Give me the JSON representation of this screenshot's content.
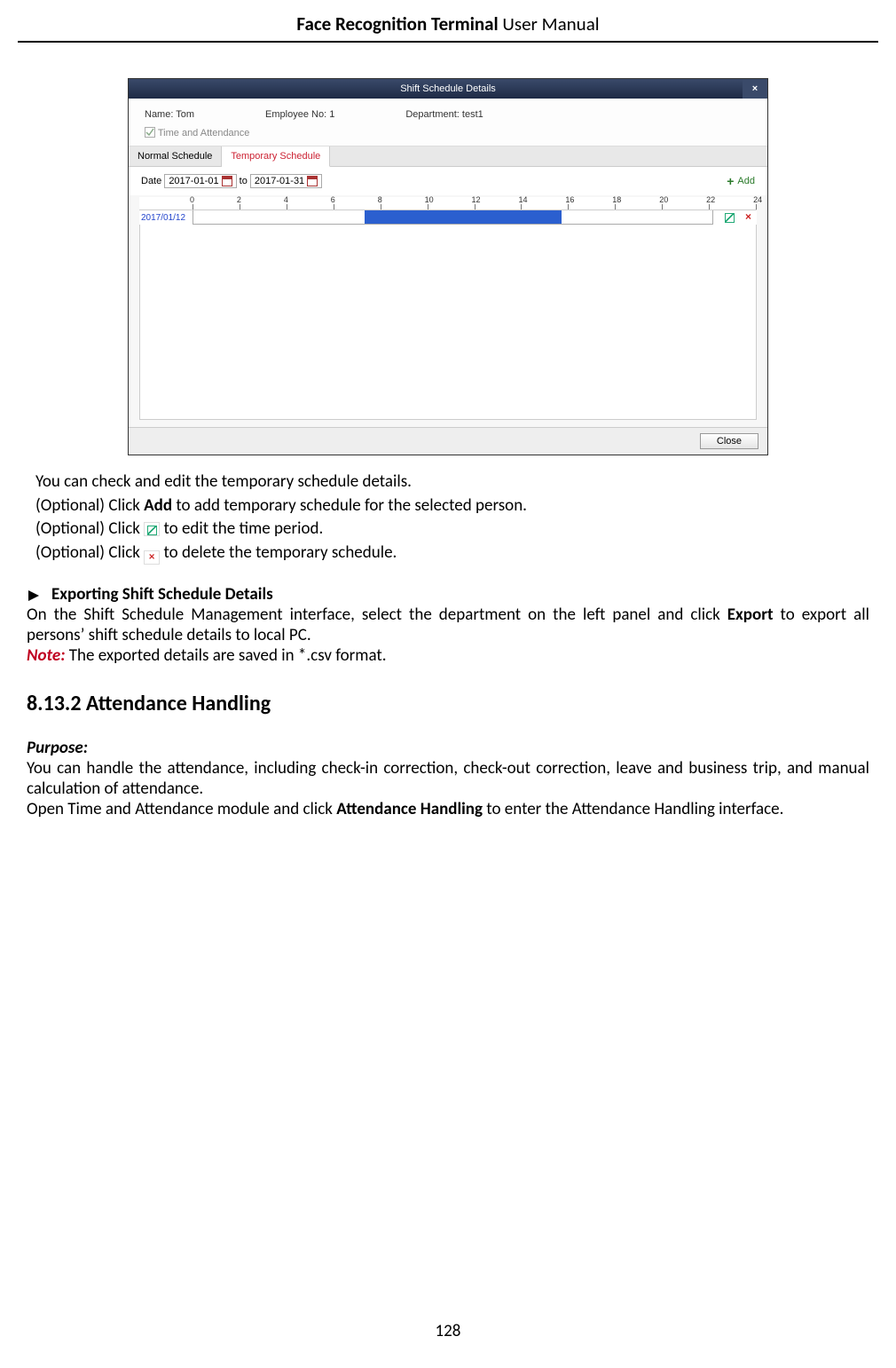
{
  "header": {
    "bold": "Face Recognition Terminal",
    "regular": "  User Manual"
  },
  "figure": {
    "title": "Shift Schedule Details",
    "name_label": "Name:",
    "name_val": "Tom",
    "emp_label": "Employee No:",
    "emp_val": "1",
    "dept_label": "Department:",
    "dept_val": "test1",
    "check_label": "Time and Attendance",
    "tab1": "Normal Schedule",
    "tab2": "Temporary Schedule",
    "date_label": "Date",
    "date_from": "2017-01-01",
    "date_to_word": "to",
    "date_to": "2017-01-31",
    "add_label": "Add",
    "ticks": [
      "0",
      "2",
      "4",
      "6",
      "8",
      "10",
      "12",
      "14",
      "16",
      "18",
      "20",
      "22",
      "24"
    ],
    "row_date": "2017/01/12",
    "close_btn": "Close"
  },
  "text": {
    "l1": "You can check and edit the temporary schedule details.",
    "l2a": "(Optional) Click ",
    "l2b": "Add",
    "l2c": " to add temporary schedule for the selected person.",
    "l3a": "(Optional) Click ",
    "l3b": " to edit the time period.",
    "l4a": "(Optional) Click ",
    "l4b": " to delete the temporary schedule.",
    "export_head": "Exporting Shift Schedule Details",
    "export_p1a": "On the Shift Schedule Management interface, select the department on the left panel and click ",
    "export_p1b": "Export",
    "export_p1c": " to export all persons’ shift schedule details to local PC.",
    "note_label": "Note:",
    "note_body": " The exported details are saved in *.csv format.",
    "section": "8.13.2 Attendance Handling",
    "purpose": "Purpose:",
    "pp1": "You can handle the attendance, including check-in correction, check-out correction, leave and business trip, and manual calculation of attendance.",
    "pp2a": "Open Time and Attendance module and click ",
    "pp2b": "Attendance Handling",
    "pp2c": " to enter the Attendance Handling interface."
  },
  "page_number": "128"
}
